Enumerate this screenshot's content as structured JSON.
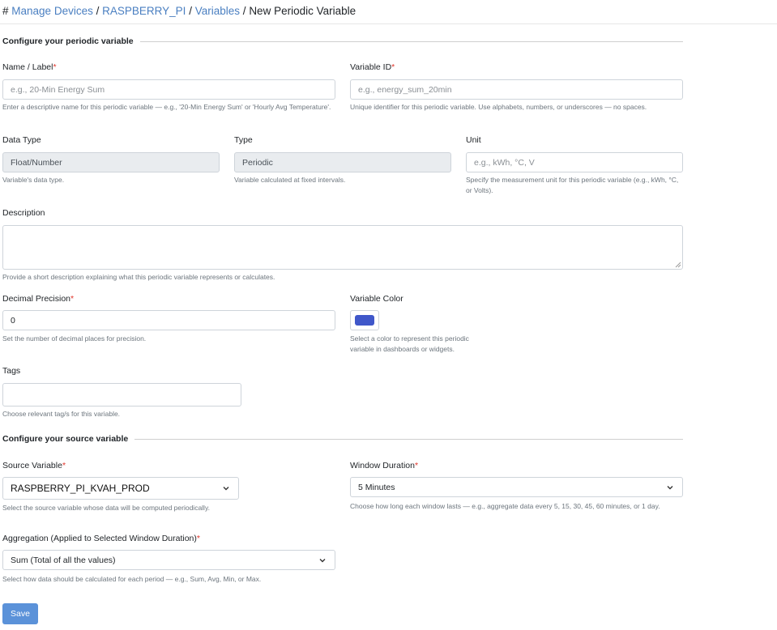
{
  "breadcrumb": {
    "prefix": "#",
    "manage_devices": "Manage Devices",
    "device": "RASPBERRY_PI",
    "variables": "Variables",
    "current": "New Periodic Variable",
    "separator": "/"
  },
  "section_periodic": {
    "title": "Configure your periodic variable"
  },
  "name_field": {
    "label": "Name / Label",
    "required_mark": "*",
    "placeholder": "e.g., 20-Min Energy Sum",
    "help": "Enter a descriptive name for this periodic variable — e.g., '20-Min Energy Sum' or 'Hourly Avg Temperature'."
  },
  "variable_id_field": {
    "label": "Variable ID",
    "required_mark": "*",
    "placeholder": "e.g., energy_sum_20min",
    "help": "Unique identifier for this periodic variable. Use alphabets, numbers, or underscores — no spaces."
  },
  "data_type_field": {
    "label": "Data Type",
    "value": "Float/Number",
    "help": "Variable's data type."
  },
  "type_field": {
    "label": "Type",
    "value": "Periodic",
    "help": "Variable calculated at fixed intervals."
  },
  "unit_field": {
    "label": "Unit",
    "placeholder": "e.g., kWh, °C, V",
    "help": "Specify the measurement unit for this periodic variable (e.g., kWh, °C, or Volts)."
  },
  "description_field": {
    "label": "Description",
    "value": "",
    "help": "Provide a short description explaining what this periodic variable represents or calculates."
  },
  "decimal_field": {
    "label": "Decimal Precision",
    "required_mark": "*",
    "value": "0",
    "help": "Set the number of decimal places for precision."
  },
  "color_field": {
    "label": "Variable Color",
    "color": "#3f57c9",
    "help_line1": "Select a color to represent this periodic",
    "help_line2": "variable in dashboards or widgets."
  },
  "tags_field": {
    "label": "Tags",
    "value": "",
    "help": "Choose relevant tag/s for this variable."
  },
  "section_source": {
    "title": "Configure your source variable"
  },
  "source_field": {
    "label": "Source Variable",
    "required_mark": "*",
    "value": "RASPBERRY_PI_KVAH_PROD",
    "icon": "chevron-down-icon",
    "help": "Select the source variable whose data will be computed periodically."
  },
  "window_field": {
    "label": "Window Duration",
    "required_mark": "*",
    "value": "5 Minutes",
    "icon": "chevron-down-icon",
    "help": "Choose how long each window lasts — e.g., aggregate data every 5, 15, 30, 45, 60 minutes, or 1 day."
  },
  "aggregation_field": {
    "label": "Aggregation (Applied to Selected Window Duration)",
    "required_mark": "*",
    "value": "Sum (Total of all the values)",
    "icon": "chevron-down-icon",
    "help": "Select how data should be calculated for each period — e.g., Sum, Avg, Min, or Max."
  },
  "actions": {
    "save_label": "Save"
  },
  "colors": {
    "link": "#4a7fc1",
    "required": "#e0352b",
    "primary_button": "#5b92d9"
  }
}
